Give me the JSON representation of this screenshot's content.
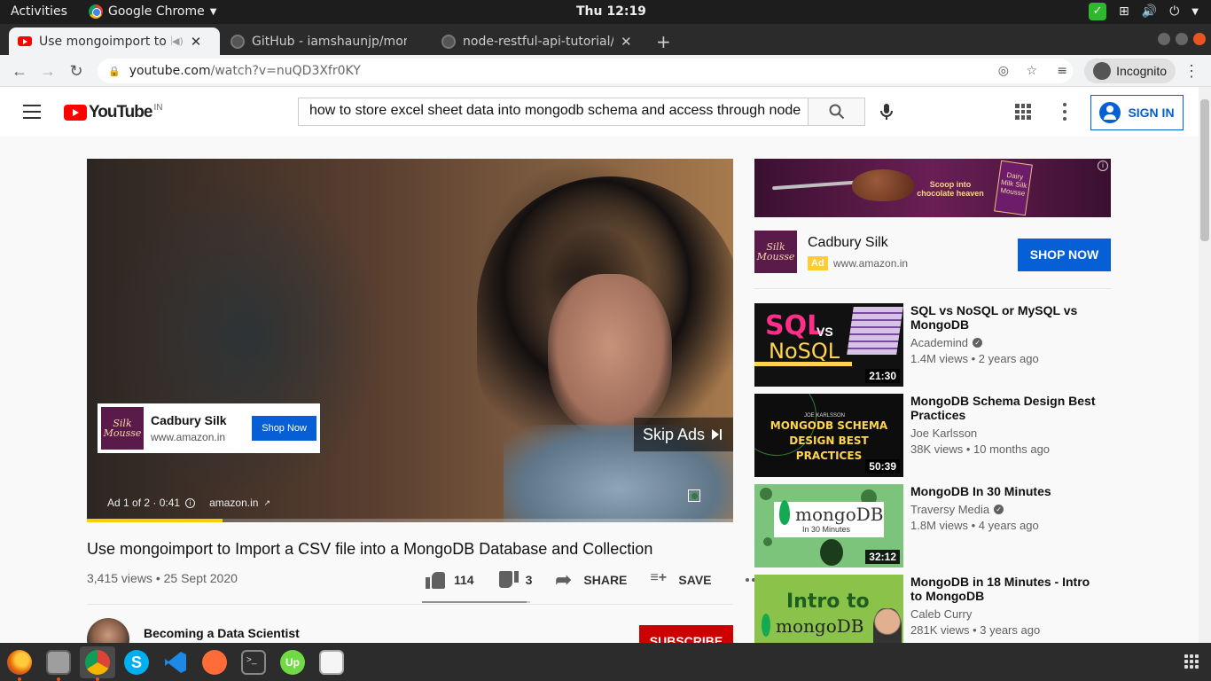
{
  "system": {
    "activities": "Activities",
    "app_name": "Google Chrome",
    "clock": "Thu 12:19"
  },
  "tabs": [
    {
      "title": "Use mongoimport to I"
    },
    {
      "title": "GitHub - iamshaunjp/mon"
    },
    {
      "title": "node-restful-api-tutorial/"
    }
  ],
  "address": {
    "url_host": "youtube.com",
    "url_path": "/watch?v=nuQD3Xfr0KY",
    "incognito_label": "Incognito"
  },
  "youtube": {
    "logo_text": "YouTube",
    "region": "IN",
    "search_value": "how to store excel sheet  data into mongodb schema and access through node",
    "sign_in": "SIGN IN"
  },
  "player": {
    "ad_brand": "Cadbury Silk",
    "ad_domain": "www.amazon.in",
    "ad_shop_button": "Shop Now",
    "skip_label": "Skip Ads",
    "ad_counter": "Ad 1 of 2 · 0:41",
    "ad_link": "amazon.in",
    "progress": 0.21,
    "logo_text": "Silk Mousse"
  },
  "video": {
    "title": "Use mongoimport to Import a CSV file into a MongoDB Database and Collection",
    "meta": "3,415 views • 25 Sept 2020",
    "likes": "114",
    "dislikes": "3",
    "share": "SHARE",
    "save": "SAVE",
    "like_ratio": 0.97
  },
  "channel": {
    "name": "Becoming a Data Scientist",
    "subscribe": "SUBSCRIBE"
  },
  "sidebar_ad": {
    "banner_text": "Scoop into chocolate heaven",
    "banner_product": "Dairy Milk Silk Mousse",
    "brand": "Cadbury Silk",
    "badge": "Ad",
    "domain": "www.amazon.in",
    "shop_now": "SHOP NOW"
  },
  "recommendations": [
    {
      "title": "SQL vs NoSQL or MySQL vs MongoDB",
      "channel": "Academind",
      "verified": true,
      "stats": "1.4M views • 2 years ago",
      "duration": "21:30",
      "thumb_text": [
        "SQL",
        "VS",
        "NoSQL"
      ]
    },
    {
      "title": "MongoDB Schema Design Best Practices",
      "channel": "Joe Karlsson",
      "verified": false,
      "stats": "38K views • 10 months ago",
      "duration": "50:39",
      "thumb_text": [
        "JOE KARLSSON",
        "MONGODB SCHEMA DESIGN BEST PRACTICES"
      ]
    },
    {
      "title": "MongoDB In 30 Minutes",
      "channel": "Traversy Media",
      "verified": true,
      "stats": "1.8M views • 4 years ago",
      "duration": "32:12",
      "thumb_text": [
        "mongoDB",
        "In 30 Minutes"
      ]
    },
    {
      "title": "MongoDB in 18 Minutes - Intro to MongoDB",
      "channel": "Caleb Curry",
      "verified": false,
      "stats": "281K views • 3 years ago",
      "duration": "",
      "thumb_text": [
        "Intro to",
        "mongoDB"
      ]
    }
  ],
  "colors": {
    "yt_red": "#ff0000",
    "accent_blue": "#065fd4",
    "subscribe_red": "#cc0000"
  },
  "dock": [
    "firefox-icon",
    "files-icon",
    "chrome-icon",
    "skype-icon",
    "vscode-icon",
    "postman-icon",
    "terminal-icon",
    "upwork-icon",
    "text-editor-icon"
  ]
}
